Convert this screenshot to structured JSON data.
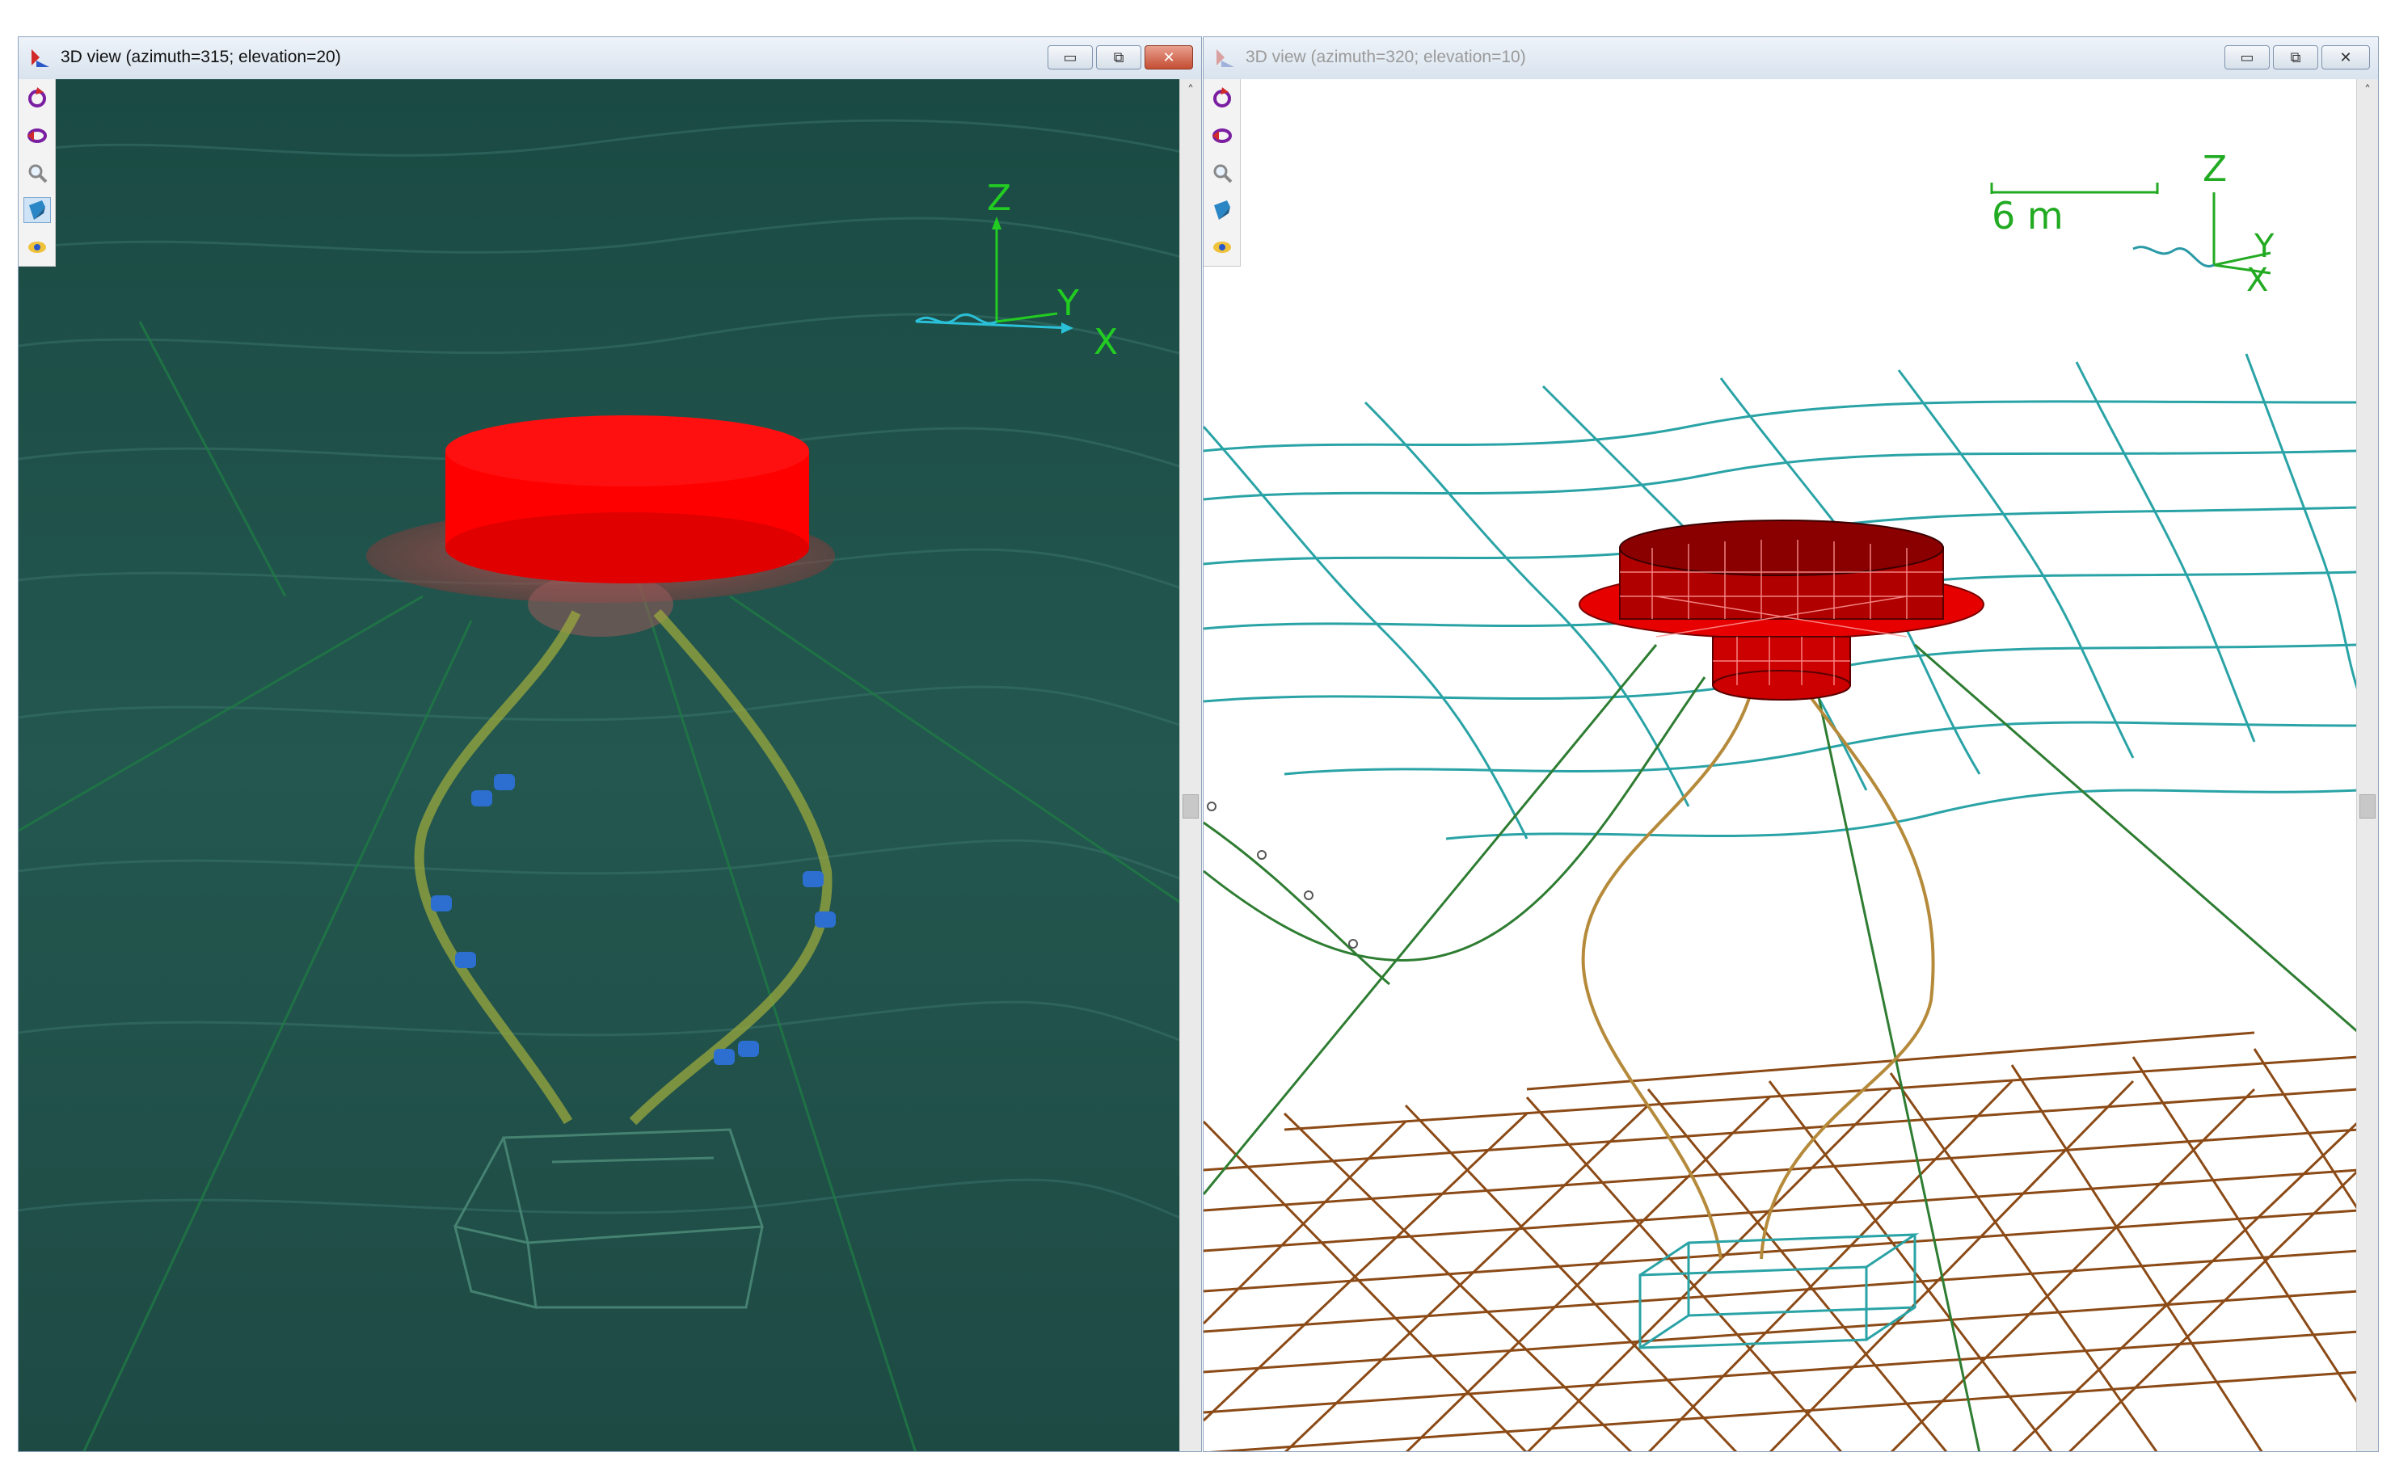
{
  "left_window": {
    "title": "3D view (azimuth=315; elevation=20)",
    "axes": {
      "z": "Z",
      "y": "Y",
      "x": "X"
    },
    "toolbar": [
      "rotate-icon",
      "pan-icon",
      "zoom-icon",
      "shaded-view-icon",
      "view-options-icon"
    ],
    "colors": {
      "sea": "#1f5048",
      "buoy": "#ff0000",
      "axis": "#22cc22"
    }
  },
  "right_window": {
    "title": "3D view (azimuth=320; elevation=10)",
    "scale_label": "6 m",
    "axes": {
      "z": "Z",
      "y": "Y",
      "x": "X"
    },
    "toolbar": [
      "rotate-icon",
      "pan-icon",
      "zoom-icon",
      "shaded-view-icon",
      "view-options-icon"
    ],
    "colors": {
      "sea_surface": "#2aa3a6",
      "seabed": "#8b4a16",
      "buoy": "#cc0000",
      "mooring": "#2e7d32",
      "axis": "#22cc22"
    }
  },
  "window_buttons": {
    "minimize": "▭",
    "maximize": "⧉",
    "close": "✕"
  }
}
